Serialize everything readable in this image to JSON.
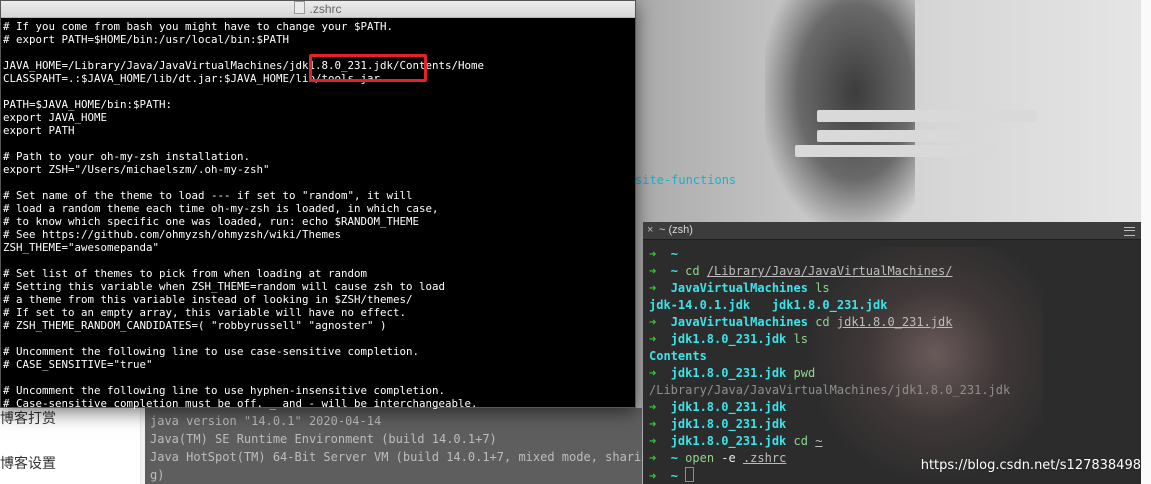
{
  "editor": {
    "title": ".zshrc",
    "lines": [
      "# If you come from bash you might have to change your $PATH.",
      "# export PATH=$HOME/bin:/usr/local/bin:$PATH",
      "",
      "JAVA_HOME=/Library/Java/JavaVirtualMachines/jdk1.8.0_231.jdk/Contents/Home",
      "CLASSPAHT=.:$JAVA_HOME/lib/dt.jar:$JAVA_HOME/lib/tools.jar",
      "",
      "PATH=$JAVA_HOME/bin:$PATH:",
      "export JAVA_HOME",
      "export PATH",
      "",
      "# Path to your oh-my-zsh installation.",
      "export ZSH=\"/Users/michaelszm/.oh-my-zsh\"",
      "",
      "# Set name of the theme to load --- if set to \"random\", it will",
      "# load a random theme each time oh-my-zsh is loaded, in which case,",
      "# to know which specific one was loaded, run: echo $RANDOM_THEME",
      "# See https://github.com/ohmyzsh/ohmyzsh/wiki/Themes",
      "ZSH_THEME=\"awesomepanda\"",
      "",
      "# Set list of themes to pick from when loading at random",
      "# Setting this variable when ZSH_THEME=random will cause zsh to load",
      "# a theme from this variable instead of looking in $ZSH/themes/",
      "# If set to an empty array, this variable will have no effect.",
      "# ZSH_THEME_RANDOM_CANDIDATES=( \"robbyrussell\" \"agnoster\" )",
      "",
      "# Uncomment the following line to use case-sensitive completion.",
      "# CASE_SENSITIVE=\"true\"",
      "",
      "# Uncomment the following line to use hyphen-insensitive completion.",
      "# Case-sensitive completion must be off. _ and - will be interchangeable."
    ],
    "highlight_color": "#e3232b"
  },
  "terminal": {
    "title": "~ (zsh)",
    "close_glyph": "×",
    "lines": [
      [
        {
          "c": "t-green",
          "t": "➜  "
        },
        {
          "c": "t-cyan",
          "t": "~"
        }
      ],
      [
        {
          "c": "t-green",
          "t": "➜  "
        },
        {
          "c": "t-cyan",
          "t": "~ "
        },
        {
          "c": "t-cmd",
          "t": "cd "
        },
        {
          "c": "t-path",
          "t": "/Library/Java/JavaVirtualMachines/"
        }
      ],
      [
        {
          "c": "t-green",
          "t": "➜  "
        },
        {
          "c": "t-cyan",
          "t": "JavaVirtualMachines "
        },
        {
          "c": "t-cmd",
          "t": "ls"
        }
      ],
      [
        {
          "c": "t-cyan",
          "t": "jdk-14.0.1.jdk   jdk1.8.0_231.jdk"
        }
      ],
      [
        {
          "c": "t-green",
          "t": "➜  "
        },
        {
          "c": "t-cyan",
          "t": "JavaVirtualMachines "
        },
        {
          "c": "t-cmd",
          "t": "cd "
        },
        {
          "c": "t-path",
          "t": "jdk1.8.0_231.jdk"
        }
      ],
      [
        {
          "c": "t-green",
          "t": "➜  "
        },
        {
          "c": "t-cyan",
          "t": "jdk1.8.0_231.jdk "
        },
        {
          "c": "t-cmd",
          "t": "ls"
        }
      ],
      [
        {
          "c": "t-cyan",
          "t": "Contents"
        }
      ],
      [
        {
          "c": "t-green",
          "t": "➜  "
        },
        {
          "c": "t-cyan",
          "t": "jdk1.8.0_231.jdk "
        },
        {
          "c": "t-cmd",
          "t": "pwd"
        }
      ],
      [
        {
          "c": "t-gray",
          "t": "/Library/Java/JavaVirtualMachines/jdk1.8.0_231.jdk"
        }
      ],
      [
        {
          "c": "t-green",
          "t": "➜  "
        },
        {
          "c": "t-cyan",
          "t": "jdk1.8.0_231.jdk"
        }
      ],
      [
        {
          "c": "t-green",
          "t": "➜  "
        },
        {
          "c": "t-cyan",
          "t": "jdk1.8.0_231.jdk"
        }
      ],
      [
        {
          "c": "t-green",
          "t": "➜  "
        },
        {
          "c": "t-cyan",
          "t": "jdk1.8.0_231.jdk "
        },
        {
          "c": "t-cmd",
          "t": "cd "
        },
        {
          "c": "t-path",
          "t": "~"
        }
      ],
      [
        {
          "c": "t-green",
          "t": "➜  "
        },
        {
          "c": "t-cyan",
          "t": "~ "
        },
        {
          "c": "t-cmd",
          "t": "open "
        },
        {
          "c": "t-white",
          "t": "-e "
        },
        {
          "c": "t-path",
          "t": ".zshrc"
        }
      ],
      [
        {
          "c": "t-green",
          "t": "➜  "
        },
        {
          "c": "t-cyan",
          "t": "~ "
        }
      ]
    ]
  },
  "background": {
    "blog_sidebar": [
      "博客打赏",
      "博客设置"
    ],
    "bg_link_text": "site-functions",
    "bg_terminal_lines": [
      "java version \"14.0.1\" 2020-04-14",
      "Java(TM) SE Runtime Environment (build 14.0.1+7)",
      "Java HotSpot(TM) 64-Bit Server VM (build 14.0.1+7, mixed mode, sharin",
      "g)"
    ]
  },
  "watermark": "https://blog.csdn.net/s127838498"
}
